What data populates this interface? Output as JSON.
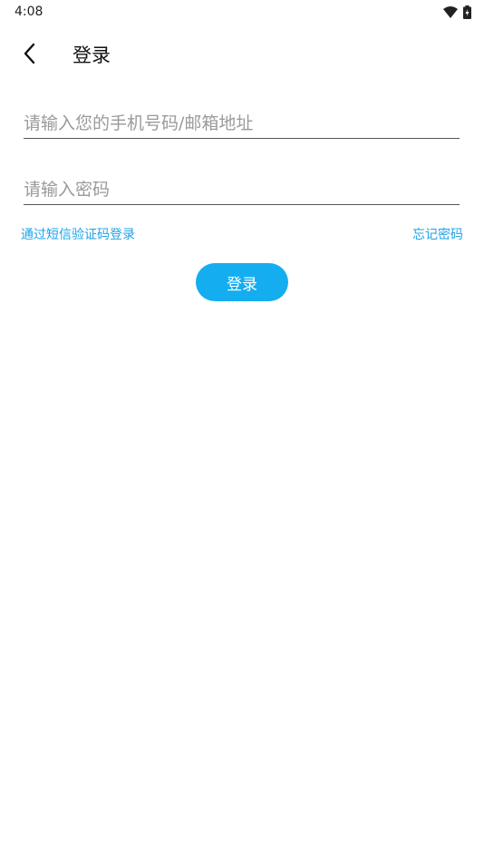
{
  "status_bar": {
    "time": "4:08",
    "icons": [
      "wifi-icon",
      "battery-icon"
    ]
  },
  "toolbar": {
    "back_icon": "chevron-left-icon",
    "title": "登录"
  },
  "form": {
    "account_placeholder": "请输入您的手机号码/邮箱地址",
    "account_value": "",
    "password_placeholder": "请输入密码",
    "password_value": ""
  },
  "links": {
    "sms_login": "通过短信验证码登录",
    "forgot_password": "忘记密码"
  },
  "buttons": {
    "login_label": "登录"
  },
  "colors": {
    "accent": "#14aef0",
    "link": "#1fa3e6",
    "underline": "#555555",
    "placeholder": "#9a9a9a"
  }
}
